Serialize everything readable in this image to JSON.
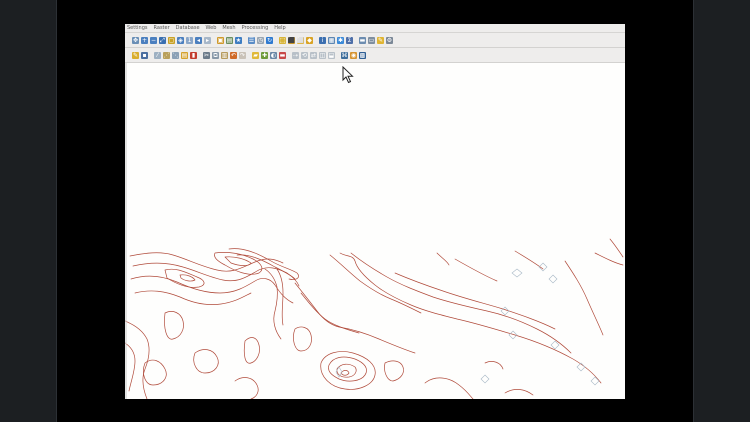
{
  "menubar": {
    "items": [
      "Settings",
      "Raster",
      "Database",
      "Web",
      "Mesh",
      "Processing",
      "Help"
    ]
  },
  "toolbar1": {
    "icons": [
      {
        "name": "pan-map-icon",
        "color": "#6a8fb6",
        "glyph": "✥"
      },
      {
        "name": "zoom-in-icon",
        "color": "#4b7fbf",
        "glyph": "+"
      },
      {
        "name": "zoom-out-icon",
        "color": "#4b7fbf",
        "glyph": "−"
      },
      {
        "name": "zoom-full-icon",
        "color": "#3a6fb0",
        "glyph": "⤢"
      },
      {
        "name": "zoom-selection-icon",
        "color": "#c9a227",
        "glyph": "▢"
      },
      {
        "name": "zoom-layer-icon",
        "color": "#4b7fbf",
        "glyph": "◈"
      },
      {
        "name": "zoom-native-icon",
        "color": "#8aa6c8",
        "glyph": "1"
      },
      {
        "name": "zoom-last-icon",
        "color": "#4b7fbf",
        "glyph": "◂"
      },
      {
        "name": "zoom-next-icon",
        "color": "#a7b7c9",
        "glyph": "▸"
      },
      {
        "name": "new-map-view-icon",
        "color": "#d09a2c",
        "glyph": "▣"
      },
      {
        "name": "new-3d-view-icon",
        "color": "#6b8f5f",
        "glyph": "▤"
      },
      {
        "name": "bookmark-icon",
        "color": "#3e7dc2",
        "glyph": "★"
      },
      {
        "name": "show-bookmarks-icon",
        "color": "#5a8cc6",
        "glyph": "☰"
      },
      {
        "name": "temporal-icon",
        "color": "#9aa6b2",
        "glyph": "◷"
      },
      {
        "name": "refresh-icon",
        "color": "#2f7ad0",
        "glyph": "↻"
      }
    ],
    "icons2": [
      {
        "name": "identify-features-icon",
        "color": "#d8b53a",
        "glyph": "⬚"
      },
      {
        "name": "select-features-icon",
        "color": "#e0a21c",
        "glyph": "⬛"
      },
      {
        "name": "deselect-features-icon",
        "color": "#e6b42c",
        "glyph": "⬜"
      },
      {
        "name": "select-location-icon",
        "color": "#d9a325",
        "glyph": "◆"
      },
      {
        "name": "identify-icon",
        "color": "#3c6fb0",
        "glyph": "i"
      },
      {
        "name": "attribute-table-icon",
        "color": "#5e87b3",
        "glyph": "▦"
      },
      {
        "name": "field-calculator-icon",
        "color": "#3b8ad8",
        "glyph": "✱"
      },
      {
        "name": "statistics-icon",
        "color": "#4e6fa8",
        "glyph": "Σ"
      },
      {
        "name": "measure-icon",
        "color": "#6d8db0",
        "glyph": "▬"
      },
      {
        "name": "annotation-icon",
        "color": "#7f8fa0",
        "glyph": "▭"
      },
      {
        "name": "map-tips-icon",
        "color": "#e0b532",
        "glyph": "✎"
      },
      {
        "name": "settings-tool-icon",
        "color": "#7b8897",
        "glyph": "⚙"
      }
    ]
  },
  "toolbar2": {
    "icons": [
      {
        "name": "toggle-editing-icon",
        "color": "#d9ad2c",
        "glyph": "✎"
      },
      {
        "name": "save-edits-icon",
        "color": "#4a6ea0",
        "glyph": "▪"
      },
      {
        "name": "digitize-line-icon",
        "color": "#9db0c2",
        "glyph": "⁄"
      },
      {
        "name": "vertex-tool-icon",
        "color": "#b9a05a",
        "glyph": "⋰"
      },
      {
        "name": "modify-attributes-icon",
        "color": "#8aa0b6",
        "glyph": "⋱"
      },
      {
        "name": "multi-edit-icon",
        "color": "#d4a12e",
        "glyph": "▤"
      },
      {
        "name": "delete-selected-icon",
        "color": "#c33d2f",
        "glyph": "▮"
      },
      {
        "name": "cut-features-icon",
        "color": "#6c7b8a",
        "glyph": "✂"
      },
      {
        "name": "copy-features-icon",
        "color": "#8898a8",
        "glyph": "⧉"
      },
      {
        "name": "paste-features-icon",
        "color": "#b69b5e",
        "glyph": "▥"
      },
      {
        "name": "undo-icon",
        "color": "#d06a28",
        "glyph": "↶"
      },
      {
        "name": "redo-icon",
        "color": "#c9c2b8",
        "glyph": "↷"
      },
      {
        "name": "label-tool-icon",
        "color": "#e0b93a",
        "glyph": "▰"
      },
      {
        "name": "plugins-icon",
        "color": "#6e9a3a",
        "glyph": "✚"
      },
      {
        "name": "label-pin-icon",
        "color": "#6b88a6",
        "glyph": "◐"
      },
      {
        "name": "label-show-icon",
        "color": "#c84848",
        "glyph": "▬"
      },
      {
        "name": "label-move-icon",
        "color": "#b8c0c8",
        "glyph": "⇢"
      },
      {
        "name": "label-rotate-icon",
        "color": "#b8c0c8",
        "glyph": "⟲"
      },
      {
        "name": "label-change-icon",
        "color": "#b8c0c8",
        "glyph": "⇄"
      },
      {
        "name": "label-diagram-icon",
        "color": "#b8c0c8",
        "glyph": "◫"
      },
      {
        "name": "label-callout-icon",
        "color": "#b8c0c8",
        "glyph": "⬓"
      },
      {
        "name": "python-console-icon",
        "color": "#3d6e9c",
        "glyph": "⌘"
      },
      {
        "name": "open-street-map-icon",
        "color": "#d69432",
        "glyph": "◉"
      },
      {
        "name": "georeferencer-icon",
        "color": "#2e5e93",
        "glyph": "▩"
      }
    ]
  }
}
